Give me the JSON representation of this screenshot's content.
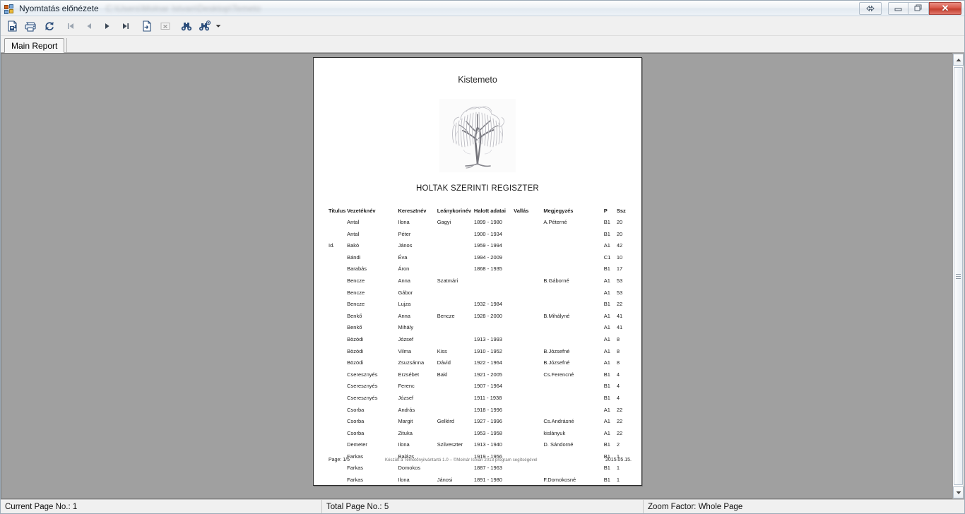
{
  "window": {
    "title": "Nyomtatás előnézete",
    "path_blurred": "C:\\Users\\Molnar Istvan\\Desktop\\Temeto",
    "icon": "app-report-icon",
    "buttons": {
      "resize": "resize-arrows",
      "minimize": "minimize",
      "maximize": "restore",
      "close": "✕"
    }
  },
  "toolbar": {
    "items": [
      {
        "name": "export-report",
        "title": "Export Report"
      },
      {
        "name": "print-report",
        "title": "Print Report"
      },
      {
        "name": "refresh-report",
        "title": "Refresh"
      },
      {
        "name": "first-page",
        "title": "Go To First Page"
      },
      {
        "name": "previous-page",
        "title": "Go To Previous Page"
      },
      {
        "name": "next-page",
        "title": "Go To Next Page"
      },
      {
        "name": "last-page",
        "title": "Go To Last Page"
      },
      {
        "name": "go-to-page",
        "title": "Go To Page"
      },
      {
        "name": "close-current-view",
        "title": "Close Current View"
      },
      {
        "name": "find-text",
        "title": "Find Text"
      },
      {
        "name": "zoom-find",
        "title": "Search"
      },
      {
        "name": "zoom-dropdown",
        "title": "Dropdown"
      }
    ]
  },
  "tabs": {
    "items": [
      {
        "label": "Main Report",
        "active": true
      }
    ]
  },
  "report": {
    "title": "Kistemeto",
    "subtitle": "HOLTAK SZERINTI REGISZTER",
    "logo": "weeping-willow-tree",
    "columns": [
      "Titulus",
      "Vezetéknév",
      "Keresztnév",
      "Leánykorinév",
      "Halott adatai",
      "Vallás",
      "Megjegyzés",
      "P",
      "Ssz"
    ],
    "rows": [
      [
        "",
        "Antal",
        "Ilona",
        "Gagyi",
        "1899 - 1980",
        "",
        "A.Péterné",
        "B1",
        "20"
      ],
      [
        "",
        "Antal",
        "Péter",
        "",
        "1900 - 1934",
        "",
        "",
        "B1",
        "20"
      ],
      [
        "Id.",
        "Bakó",
        "János",
        "",
        "1959 - 1994",
        "",
        "",
        "A1",
        "42"
      ],
      [
        "",
        "Bándi",
        "Éva",
        "",
        "1994 - 2009",
        "",
        "",
        "C1",
        "10"
      ],
      [
        "",
        "Barabás",
        "Áron",
        "",
        "1868 - 1935",
        "",
        "",
        "B1",
        "17"
      ],
      [
        "",
        "Bencze",
        "Anna",
        "Szatmári",
        "",
        "",
        "B.Gáborné",
        "A1",
        "53"
      ],
      [
        "",
        "Bencze",
        "Gábor",
        "",
        "",
        "",
        "",
        "A1",
        "53"
      ],
      [
        "",
        "Bencze",
        "Lujza",
        "",
        "1932 - 1984",
        "",
        "",
        "B1",
        "22"
      ],
      [
        "",
        "Benkő",
        "Anna",
        "Bencze",
        "1928 - 2000",
        "",
        "B.Mihályné",
        "A1",
        "41"
      ],
      [
        "",
        "Benkő",
        "Mihály",
        "",
        "",
        "",
        "",
        "A1",
        "41"
      ],
      [
        "",
        "Bözödi",
        "József",
        "",
        "1913 - 1993",
        "",
        "",
        "A1",
        "8"
      ],
      [
        "",
        "Bözödi",
        "Vilma",
        "Kiss",
        "1910 - 1952",
        "",
        "B.Józsefné",
        "A1",
        "8"
      ],
      [
        "",
        "Bözödi",
        "Zsuzsánna",
        "Dávid",
        "1922 - 1964",
        "",
        "B.Józsefné",
        "A1",
        "8"
      ],
      [
        "",
        "Cseresznyés",
        "Erzsébet",
        "Bakl",
        "1921 - 2005",
        "",
        "Cs.Ferencné",
        "B1",
        "4"
      ],
      [
        "",
        "Cseresznyés",
        "Ferenc",
        "",
        "1907 - 1964",
        "",
        "",
        "B1",
        "4"
      ],
      [
        "",
        "Cseresznyés",
        "József",
        "",
        "1911 - 1938",
        "",
        "",
        "B1",
        "4"
      ],
      [
        "",
        "Csorba",
        "András",
        "",
        "1918 - 1996",
        "",
        "",
        "A1",
        "22"
      ],
      [
        "",
        "Csorba",
        "Margit",
        "Gellérd",
        "1927 - 1996",
        "",
        "Cs.Andrásné",
        "A1",
        "22"
      ],
      [
        "",
        "Csorba",
        "Zituka",
        "",
        "1953 - 1958",
        "",
        "kislányuk",
        "A1",
        "22"
      ],
      [
        "",
        "Demeter",
        "Ilona",
        "Szilveszter",
        "1913 - 1940",
        "",
        "D. Sándorné",
        "B1",
        "2"
      ],
      [
        "",
        "Farkas",
        "Balázs",
        "",
        "1919 - 1956",
        "",
        "",
        "B1",
        "1"
      ],
      [
        "",
        "Farkas",
        "Domokos",
        "",
        "1887 - 1963",
        "",
        "",
        "B1",
        "1"
      ],
      [
        "",
        "Farkas",
        "Ilona",
        "Jánosi",
        "1891 - 1980",
        "",
        "F.Domokosné",
        "B1",
        "1"
      ]
    ],
    "footer": {
      "page": "Page: 1/5",
      "credit": "Készült a Temetőnyilvántartó 1.0 – ©Molnár István 2013 program segítségével",
      "date": "2015.05.15."
    }
  },
  "status": {
    "current_page": "Current Page No.: 1",
    "total_page": "Total Page No.: 5",
    "zoom_factor": "Zoom Factor: Whole Page"
  },
  "colors": {
    "toolbar_icon": "#2d4f7c",
    "close_button": "#c33f2f",
    "page_background": "#a0a0a0",
    "chrome": "#f0f0f0"
  }
}
